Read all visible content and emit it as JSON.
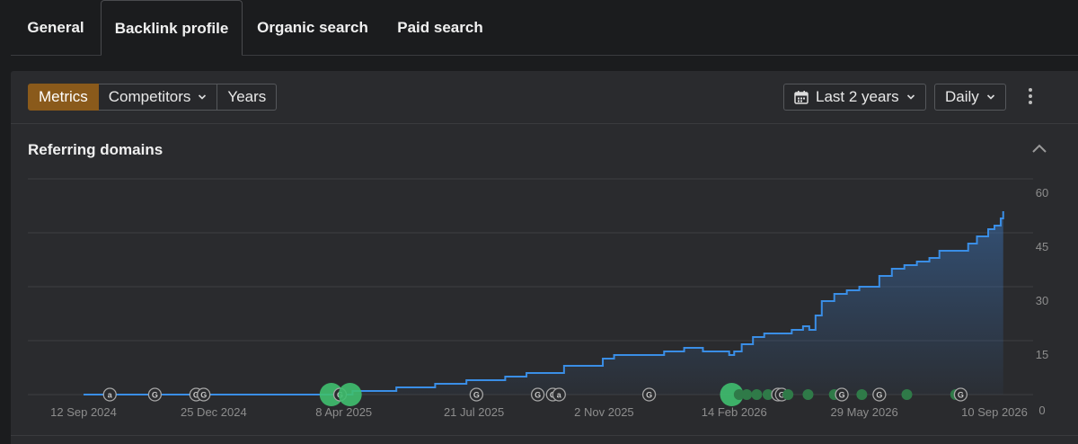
{
  "tabs": [
    {
      "label": "General",
      "active": false
    },
    {
      "label": "Backlink profile",
      "active": true
    },
    {
      "label": "Organic search",
      "active": false
    },
    {
      "label": "Paid search",
      "active": false
    }
  ],
  "toolbar": {
    "metrics_label": "Metrics",
    "competitors_label": "Competitors",
    "years_label": "Years",
    "date_range_label": "Last 2 years",
    "interval_label": "Daily"
  },
  "section": {
    "title": "Referring domains"
  },
  "colors": {
    "accent": "#8a5a1b",
    "line": "#3a8ee6",
    "event_green": "#3fbf6f",
    "event_dim": "#2f7a48"
  },
  "chart_data": {
    "type": "area",
    "xlabel": "",
    "ylabel": "",
    "x_ticks": [
      "12 Sep 2024",
      "25 Dec 2024",
      "8 Apr 2025",
      "21 Jul 2025",
      "2 Nov 2025",
      "14 Feb 2026",
      "29 May 2026",
      "10 Sep 2026"
    ],
    "y_ticks": [
      60,
      45,
      30,
      15,
      0
    ],
    "ylim": [
      0,
      60
    ],
    "grid": true,
    "series": [
      {
        "points": [
          [
            "2024-09-12",
            0
          ],
          [
            "2025-03-25",
            0
          ],
          [
            "2025-04-15",
            1
          ],
          [
            "2025-05-20",
            2
          ],
          [
            "2025-06-20",
            3
          ],
          [
            "2025-07-15",
            4
          ],
          [
            "2025-08-15",
            5
          ],
          [
            "2025-09-01",
            6
          ],
          [
            "2025-10-01",
            8
          ],
          [
            "2025-11-01",
            10
          ],
          [
            "2025-11-10",
            11
          ],
          [
            "2025-12-01",
            11
          ],
          [
            "2025-12-20",
            12
          ],
          [
            "2026-01-01",
            12
          ],
          [
            "2026-01-05",
            13
          ],
          [
            "2026-01-20",
            12
          ],
          [
            "2026-02-01",
            12
          ],
          [
            "2026-02-10",
            11
          ],
          [
            "2026-02-14",
            12
          ],
          [
            "2026-02-20",
            14
          ],
          [
            "2026-03-01",
            16
          ],
          [
            "2026-03-10",
            17
          ],
          [
            "2026-03-20",
            17
          ],
          [
            "2026-04-01",
            18
          ],
          [
            "2026-04-10",
            19
          ],
          [
            "2026-04-15",
            18
          ],
          [
            "2026-04-20",
            22
          ],
          [
            "2026-04-25",
            26
          ],
          [
            "2026-05-05",
            28
          ],
          [
            "2026-05-15",
            29
          ],
          [
            "2026-05-25",
            30
          ],
          [
            "2026-06-10",
            33
          ],
          [
            "2026-06-20",
            35
          ],
          [
            "2026-06-30",
            36
          ],
          [
            "2026-07-10",
            37
          ],
          [
            "2026-07-20",
            38
          ],
          [
            "2026-07-28",
            40
          ],
          [
            "2026-08-15",
            40
          ],
          [
            "2026-08-20",
            42
          ],
          [
            "2026-08-27",
            44
          ],
          [
            "2026-09-05",
            46
          ],
          [
            "2026-09-10",
            47
          ],
          [
            "2026-09-15",
            49
          ],
          [
            "2026-09-17",
            51
          ]
        ]
      }
    ],
    "events": [
      {
        "date": "2024-10-03",
        "kind": "a"
      },
      {
        "date": "2024-11-08",
        "kind": "G"
      },
      {
        "date": "2024-12-11",
        "kind": "G"
      },
      {
        "date": "2024-12-17",
        "kind": "G"
      },
      {
        "date": "2025-03-29",
        "kind": "dot-large"
      },
      {
        "date": "2025-04-05",
        "kind": "G"
      },
      {
        "date": "2025-04-13",
        "kind": "dot-large"
      },
      {
        "date": "2025-07-23",
        "kind": "G"
      },
      {
        "date": "2025-09-10",
        "kind": "G"
      },
      {
        "date": "2025-09-22",
        "kind": "G"
      },
      {
        "date": "2025-09-27",
        "kind": "a"
      },
      {
        "date": "2025-12-08",
        "kind": "G"
      },
      {
        "date": "2026-02-12",
        "kind": "dot-large"
      },
      {
        "date": "2026-02-18",
        "kind": "dot"
      },
      {
        "date": "2026-02-24",
        "kind": "dot"
      },
      {
        "date": "2026-03-04",
        "kind": "dot"
      },
      {
        "date": "2026-03-13",
        "kind": "dot"
      },
      {
        "date": "2026-03-21",
        "kind": "G"
      },
      {
        "date": "2026-03-24",
        "kind": "G"
      },
      {
        "date": "2026-03-29",
        "kind": "dot"
      },
      {
        "date": "2026-04-14",
        "kind": "dot"
      },
      {
        "date": "2026-05-05",
        "kind": "dot"
      },
      {
        "date": "2026-05-11",
        "kind": "G"
      },
      {
        "date": "2026-05-27",
        "kind": "dot"
      },
      {
        "date": "2026-06-10",
        "kind": "G"
      },
      {
        "date": "2026-07-02",
        "kind": "dot"
      },
      {
        "date": "2026-08-10",
        "kind": "dot"
      },
      {
        "date": "2026-08-14",
        "kind": "G"
      }
    ]
  }
}
